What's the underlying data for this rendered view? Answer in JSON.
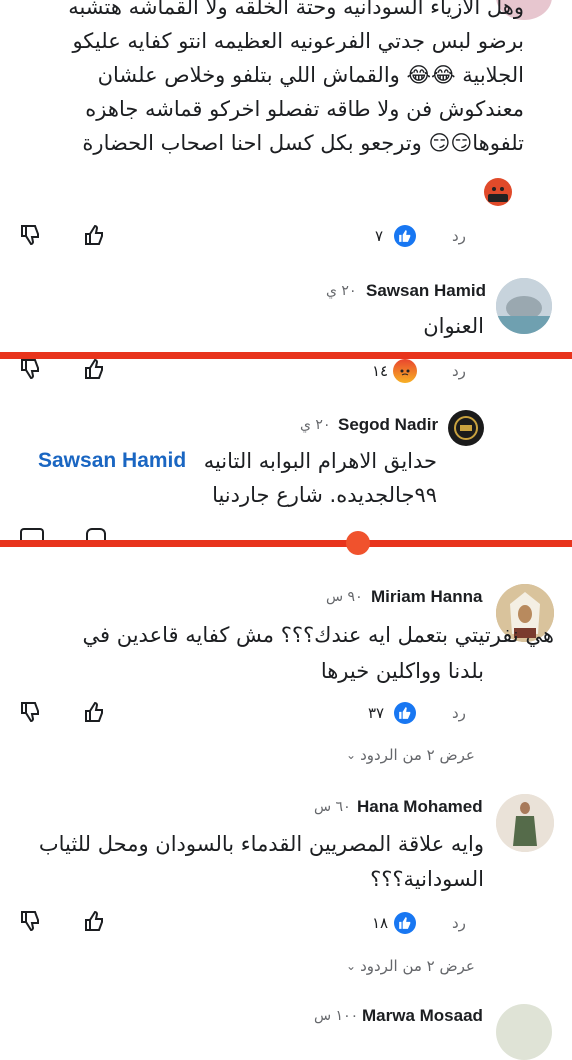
{
  "colors": {
    "accent": "#1877f2",
    "red_line": "#e8341c",
    "mention": "#1a66c2"
  },
  "comment1": {
    "lines": [
      "وهل الازياء السودانيه وحتة الخلقه ولا القماشه هتشبه",
      "برضو لبس جدتي الفرعونيه العظيمه انتو كفايه عليكو",
      "الجلابية 😂😂 والقماش اللي بتلفو وخلاص علشان",
      "معندكوش فن ولا طاقه تفصلو اخركو قماشه جاهزه",
      "تلفوها😏😏 وترجعو بكل كسل احنا اصحاب الحضارة"
    ],
    "reply_label": "رد",
    "reaction_count": "٧"
  },
  "comment2": {
    "author": "Sawsan Hamid",
    "time": "٢٠ ي",
    "text": "العنوان",
    "reply_label": "رد",
    "reaction_count": "١٤"
  },
  "comment3": {
    "author": "Segod Nadir",
    "time": "٢٠ ي",
    "mention": "Sawsan Hamid",
    "line1": "حدايق الاهرام البوابه التانيه",
    "line2": "٩٩جالجديده. شارع جاردنيا"
  },
  "comment4": {
    "author": "Miriam Hanna",
    "time": "٩٠ س",
    "line1": "هي نفرتيتي بتعمل ايه عندك؟؟؟ مش كفايه قاعدين في",
    "line2": "بلدنا وواكلين خيرها",
    "reply_label": "رد",
    "reaction_count": "٣٧",
    "view_replies": "عرض ٢ من الردود"
  },
  "comment5": {
    "author": "Hana Mohamed",
    "time": "٦٠ س",
    "line1": "وايه علاقة المصريين القدماء بالسودان ومحل للثياب",
    "line2": "السودانية؟؟؟",
    "reply_label": "رد",
    "reaction_count": "١٨",
    "view_replies": "عرض ٢ من الردود"
  },
  "comment6": {
    "author": "Marwa Mosaad",
    "time": "١٠٠ س"
  }
}
